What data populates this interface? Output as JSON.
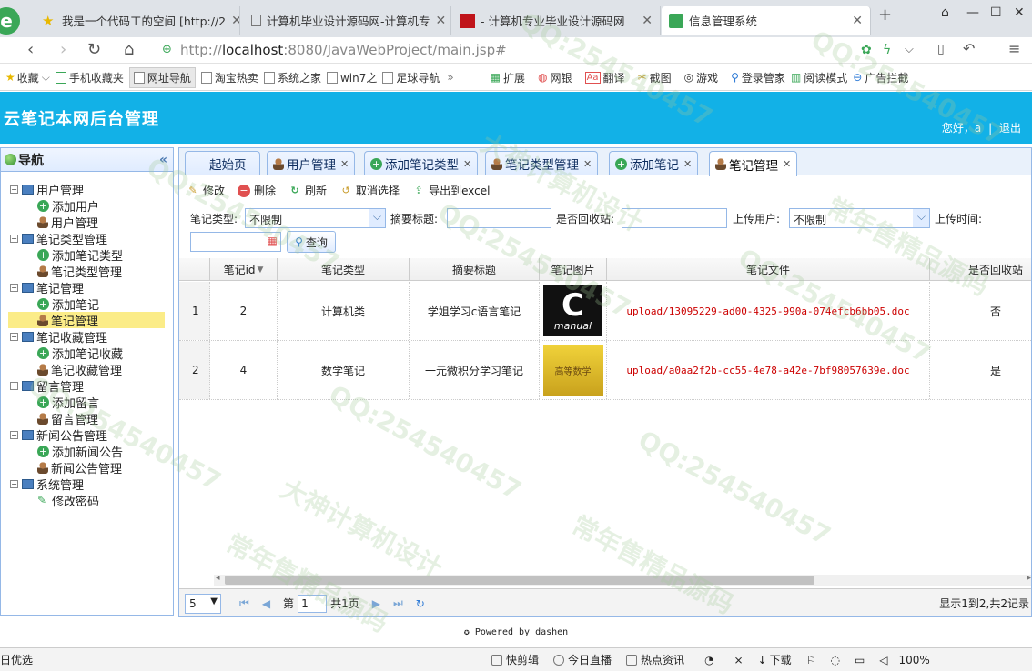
{
  "browser": {
    "tabs": [
      {
        "title": "我是一个代码工的空间 [http://2"
      },
      {
        "title": "计算机毕业设计源码网-计算机专"
      },
      {
        "title": "- 计算机专业毕业设计源码网"
      },
      {
        "title": "信息管理系统"
      }
    ],
    "url_prefix": "http://",
    "url_host": "localhost",
    "url_rest": ":8080/JavaWebProject/main.jsp#",
    "bookmarks": [
      "收藏",
      "手机收藏夹",
      "网址导航",
      "淘宝热卖",
      "系统之家",
      "win7之",
      "足球导航",
      "扩展",
      "网银",
      "翻译",
      "截图",
      "游戏",
      "登录管家",
      "阅读模式",
      "广告拦截"
    ]
  },
  "app": {
    "title": "云笔记本网后台管理",
    "greeting": "您好，a",
    "logout": "退出",
    "footer": "Powered by dashen"
  },
  "nav": {
    "title": "导航",
    "collapse": "«",
    "groups": [
      {
        "label": "用户管理",
        "items": [
          "添加用户",
          "用户管理"
        ]
      },
      {
        "label": "笔记类型管理",
        "items": [
          "添加笔记类型",
          "笔记类型管理"
        ]
      },
      {
        "label": "笔记管理",
        "items": [
          "添加笔记",
          "笔记管理"
        ]
      },
      {
        "label": "笔记收藏管理",
        "items": [
          "添加笔记收藏",
          "笔记收藏管理"
        ]
      },
      {
        "label": "留言管理",
        "items": [
          "添加留言",
          "留言管理"
        ]
      },
      {
        "label": "新闻公告管理",
        "items": [
          "添加新闻公告",
          "新闻公告管理"
        ]
      },
      {
        "label": "系统管理",
        "items": [
          "修改密码"
        ]
      }
    ]
  },
  "tabs": [
    "起始页",
    "用户管理",
    "添加笔记类型",
    "笔记类型管理",
    "添加笔记",
    "笔记管理"
  ],
  "toolbar": {
    "edit": "修改",
    "delete": "删除",
    "refresh": "刷新",
    "unselect": "取消选择",
    "export": "导出到excel"
  },
  "filters": {
    "type_label": "笔记类型:",
    "type_value": "不限制",
    "title_label": "摘要标题:",
    "title_value": "",
    "recycle_label": "是否回收站:",
    "recycle_value": "",
    "user_label": "上传用户:",
    "user_value": "不限制",
    "time_label": "上传时间:",
    "time_value": "",
    "query": "查询"
  },
  "table": {
    "columns": [
      "笔记id",
      "笔记类型",
      "摘要标题",
      "笔记图片",
      "笔记文件",
      "是否回收站"
    ],
    "rows": [
      {
        "rownum": "1",
        "id": "2",
        "type": "计算机类",
        "title": "学姐学习c语言笔记",
        "image_letter": "C",
        "image_caption": "manual",
        "file": "upload/13095229-ad00-4325-990a-074efcb6bb05.doc",
        "recycled": "否"
      },
      {
        "rownum": "2",
        "id": "4",
        "type": "数学笔记",
        "title": "一元微积分学习笔记",
        "image_letter": "",
        "image_caption": "高等数学",
        "file": "upload/a0aa2f2b-cc55-4e78-a42e-7bf98057639e.doc",
        "recycled": "是"
      }
    ]
  },
  "pager": {
    "page_size": "5",
    "page_label": "第",
    "page_value": "1",
    "total_pages": "共1页",
    "info": "显示1到2,共2记录"
  },
  "statusbar": {
    "left": "日优选",
    "items": [
      "快剪辑",
      "今日直播",
      "热点资讯",
      "下载",
      "100%"
    ]
  },
  "watermarks": [
    "QQ:254540457",
    "常年售精品源码",
    "大神计算机设计"
  ]
}
